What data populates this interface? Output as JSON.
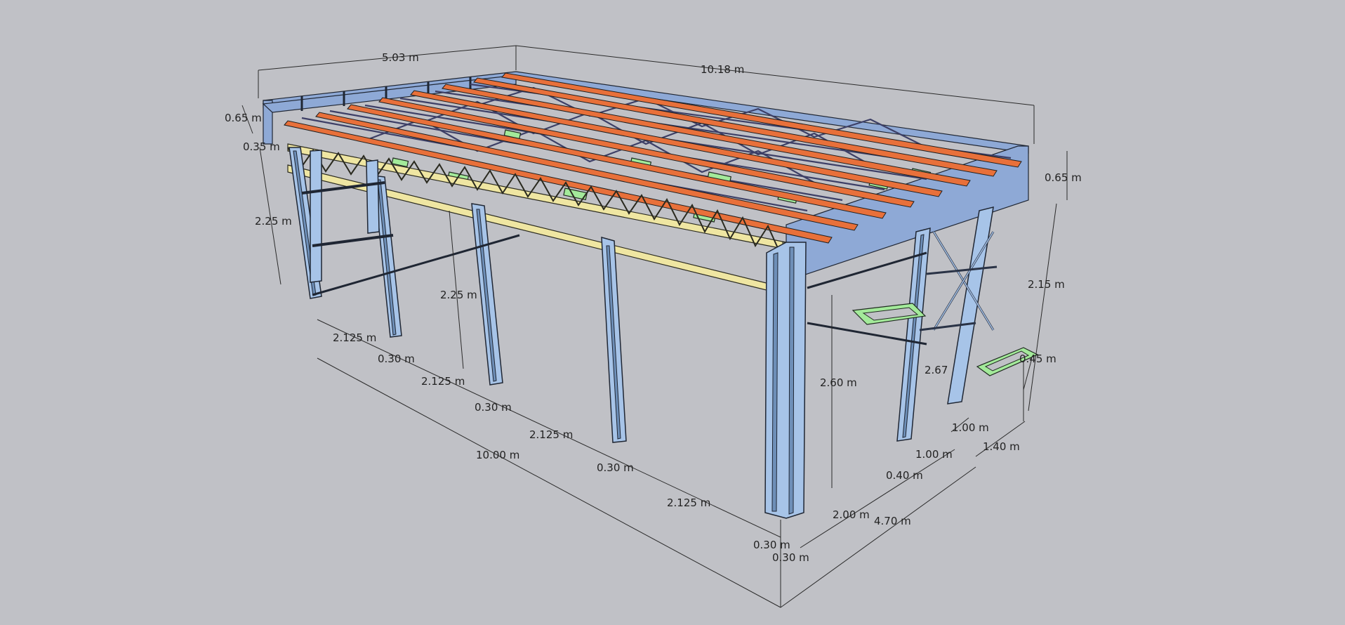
{
  "colors": {
    "background": "#c0c1c6",
    "steel_blue": "#a7c4e8",
    "purlin_orange": "#e8703a",
    "truss_yellow": "#efe6a2",
    "deck_green": "#a3ea9a",
    "lattice_purple": "#6c6fb0",
    "line": "#2a2a2a"
  },
  "dimensions": {
    "roof_width": "5.03 m",
    "roof_length": "10.18 m",
    "parapet_left": "0.65 m",
    "truss_offset": "0.35 m",
    "front_column_height": "2.25 m",
    "inner_column_height": "2.25 m",
    "parapet_right": "0.65 m",
    "right_column_height": "2.15 m",
    "corner_column_height": "2.60 m",
    "partial_label": "2.67",
    "step_height": "0.45 m",
    "spacing_1": "2.125 m",
    "spacing_2": "2.125 m",
    "spacing_3": "2.125 m",
    "spacing_4": "2.125 m",
    "col_width_1": "0.30 m",
    "col_width_2": "0.30 m",
    "col_width_3": "0.30 m",
    "col_width_4": "0.30 m",
    "col_width_5": "0.30 m",
    "total_length": "10.00 m",
    "side_bay": "2.00 m",
    "side_total": "4.70 m",
    "side_col": "0.40 m",
    "platform_1": "1.00 m",
    "platform_2": "1.00 m",
    "platform_depth": "1.40 m"
  }
}
